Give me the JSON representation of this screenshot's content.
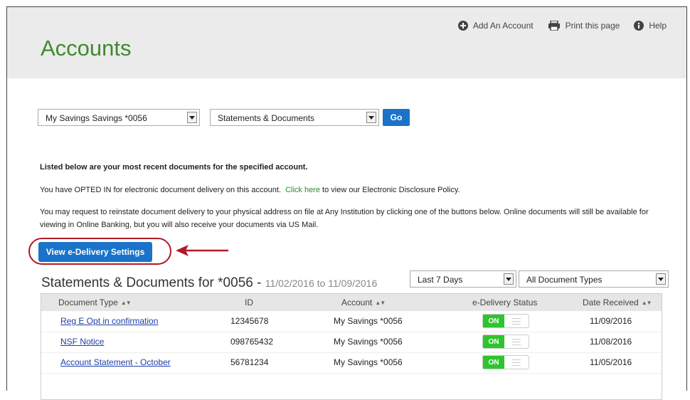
{
  "header": {
    "title": "Accounts",
    "links": {
      "add_account": "Add An Account",
      "print": "Print this page",
      "help": "Help"
    }
  },
  "filters": {
    "account_select": "My Savings Savings *0056",
    "doc_select": "Statements & Documents",
    "go_label": "Go"
  },
  "info": {
    "line1": "Listed below are your most recent documents for the specified account.",
    "line2_pre": "You have OPTED IN for electronic document delivery on this account.",
    "line2_link": "Click here",
    "line2_post": "to view our Electronic Disclosure Policy.",
    "line3": "You may request to reinstate document delivery to your physical address on file at Any Institution by clicking one of the buttons below. Online documents will still be available for viewing in Online Banking, but you will also receive your documents via US Mail."
  },
  "edelivery_button": "View e-Delivery Settings",
  "section": {
    "title": "Statements & Documents for *0056 - ",
    "dates": "11/02/2016 to 11/09/2016",
    "range_select": "Last 7 Days",
    "type_select": "All Document Types"
  },
  "table": {
    "headers": {
      "doc_type": "Document Type",
      "id": "ID",
      "account": "Account",
      "status": "e-Delivery Status",
      "date": "Date Received"
    },
    "rows": [
      {
        "doc": "Reg E Opt in confirmation",
        "id": "12345678",
        "account": "My Savings *0056",
        "status": "ON",
        "date": "11/09/2016"
      },
      {
        "doc": "NSF Notice",
        "id": "098765432",
        "account": "My Savings *0056",
        "status": "ON",
        "date": "11/08/2016"
      },
      {
        "doc": "Account Statement - October",
        "id": "56781234",
        "account": "My Savings *0056",
        "status": "ON",
        "date": "11/05/2016"
      }
    ]
  },
  "colors": {
    "title_green": "#3f8a2e",
    "button_blue": "#1a73c9",
    "annotation_red": "#b11a28",
    "toggle_green": "#2ec42e"
  }
}
